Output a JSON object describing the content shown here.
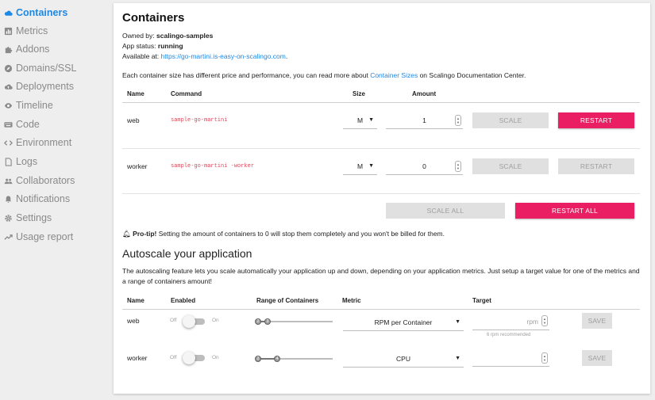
{
  "sidebar": {
    "items": [
      {
        "label": "Containers",
        "icon": "cloud-icon",
        "active": true
      },
      {
        "label": "Metrics",
        "icon": "bar-chart-icon"
      },
      {
        "label": "Addons",
        "icon": "puzzle-icon"
      },
      {
        "label": "Domains/SSL",
        "icon": "compass-icon"
      },
      {
        "label": "Deployments",
        "icon": "cloud-upload-icon"
      },
      {
        "label": "Timeline",
        "icon": "eye-icon"
      },
      {
        "label": "Code",
        "icon": "keyboard-icon"
      },
      {
        "label": "Environment",
        "icon": "code-icon"
      },
      {
        "label": "Logs",
        "icon": "file-icon"
      },
      {
        "label": "Collaborators",
        "icon": "people-icon"
      },
      {
        "label": "Notifications",
        "icon": "bell-icon"
      },
      {
        "label": "Settings",
        "icon": "gear-icon"
      },
      {
        "label": "Usage report",
        "icon": "trending-icon"
      }
    ]
  },
  "containers": {
    "title": "Containers",
    "owned_by_label": "Owned by:",
    "owned_by": "scalingo-samples",
    "status_label": "App status:",
    "status": "running",
    "available_label": "Available at:",
    "url": "https://go-martini.is-easy-on-scalingo.com",
    "url_suffix": ".",
    "info_pre": "Each container size has different price and performance, you can read more about",
    "info_link": "Container Sizes",
    "info_post": "on Scalingo Documentation Center.",
    "headers": {
      "name": "Name",
      "command": "Command",
      "size": "Size",
      "amount": "Amount"
    },
    "rows": [
      {
        "name": "web",
        "command": "sample-go-martini",
        "size": "M",
        "amount": "1",
        "scale": "SCALE",
        "restart": "RESTART"
      },
      {
        "name": "worker",
        "command": "sample-go-martini -worker",
        "size": "M",
        "amount": "0",
        "scale": "SCALE",
        "restart": "RESTART"
      }
    ],
    "scale_all": "SCALE ALL",
    "restart_all": "RESTART ALL",
    "protip_label": "Pro-tip!",
    "protip_text": "Setting the amount of containers to 0 will stop them completely and you won't be billed for them."
  },
  "autoscale": {
    "title": "Autoscale your application",
    "description_1": "The autoscaling feature lets you scale automatically your application up and down, depending on your application metrics. Just setup a target value for one of the metrics and",
    "description_2": "a range of containers amount!",
    "headers": {
      "name": "Name",
      "enabled": "Enabled",
      "range": "Range of Containers",
      "metric": "Metric",
      "target": "Target"
    },
    "rows": [
      {
        "name": "web",
        "off": "Off",
        "on": "On",
        "range_min": "2",
        "range_max": "3",
        "metric": "RPM per Container",
        "target_unit": "rpm",
        "hint": "6 rpm recommended",
        "save": "SAVE"
      },
      {
        "name": "worker",
        "off": "Off",
        "on": "On",
        "range_min": "2",
        "range_max": "4",
        "metric": "CPU",
        "target_unit": "",
        "hint": "",
        "save": "SAVE"
      }
    ]
  },
  "colors": {
    "accent": "#1e88e5",
    "danger": "#ea1e63",
    "disabled": "#e0e0e0"
  }
}
